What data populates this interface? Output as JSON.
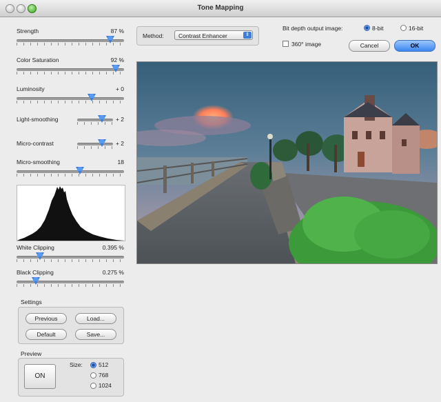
{
  "window": {
    "title": "Tone Mapping"
  },
  "sliders": [
    {
      "label": "Strength",
      "value_text": "87 %",
      "fraction": 0.87
    },
    {
      "label": "Color Saturation",
      "value_text": "92 %",
      "fraction": 0.92
    },
    {
      "label": "Luminosity",
      "value_text": "+ 0",
      "fraction": 0.7
    },
    {
      "label": "Light-smoothing",
      "value_text": "+ 2",
      "fraction": 0.7
    },
    {
      "label": "Micro-contrast",
      "value_text": "+ 2",
      "fraction": 0.7
    },
    {
      "label": "Micro-smoothing",
      "value_text": "18",
      "fraction": 0.59
    },
    {
      "label": "White Clipping",
      "value_text": "0.395 %",
      "fraction": 0.22
    },
    {
      "label": "Black Clipping",
      "value_text": "0.275 %",
      "fraction": 0.18
    }
  ],
  "settings": {
    "group_label": "Settings",
    "previous_button": "Previous",
    "load_button": "Load...",
    "default_button": "Default",
    "save_button": "Save..."
  },
  "preview": {
    "group_label": "Preview",
    "toggle_button": "ON",
    "size_label": "Size:",
    "sizes": [
      "512",
      "768",
      "1024"
    ],
    "selected_size": "512"
  },
  "method": {
    "label": "Method:",
    "value": "Contrast Enhancer"
  },
  "bit_depth": {
    "label": "Bit depth output image:",
    "options": [
      "8-bit",
      "16-bit"
    ],
    "selected": "8-bit"
  },
  "panorama": {
    "label": "360° image",
    "checked": false
  },
  "buttons": {
    "cancel": "Cancel",
    "ok": "OK"
  }
}
